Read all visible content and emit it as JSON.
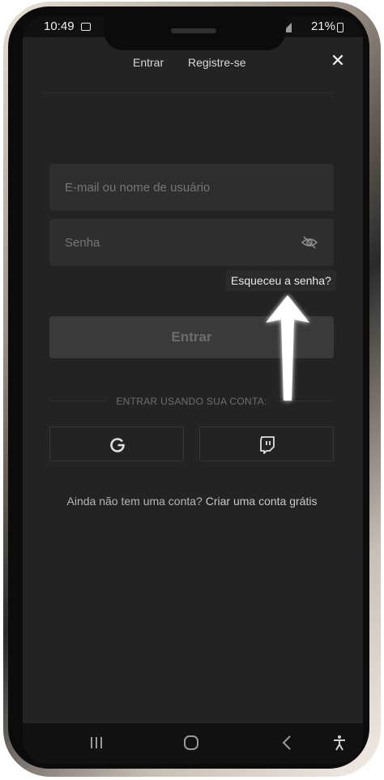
{
  "status_bar": {
    "time": "10:49",
    "battery": "21%"
  },
  "header": {
    "tabs": [
      {
        "label": "Entrar"
      },
      {
        "label": "Registre-se"
      }
    ],
    "close_icon": "close-icon"
  },
  "form": {
    "email_placeholder": "E-mail ou nome de usuário",
    "password_placeholder": "Senha",
    "forgot_password": "Esqueceu a senha?",
    "submit_label": "Entrar"
  },
  "social": {
    "label": "ENTRAR USANDO SUA CONTA:",
    "providers": [
      {
        "icon": "google-icon"
      },
      {
        "icon": "twitch-icon"
      }
    ]
  },
  "signup": {
    "prompt": "Ainda não tem uma conta?",
    "link": "Criar uma conta grátis"
  },
  "colors": {
    "background": "#232323",
    "field": "#2e2e2e",
    "button": "#3a3a3a"
  }
}
